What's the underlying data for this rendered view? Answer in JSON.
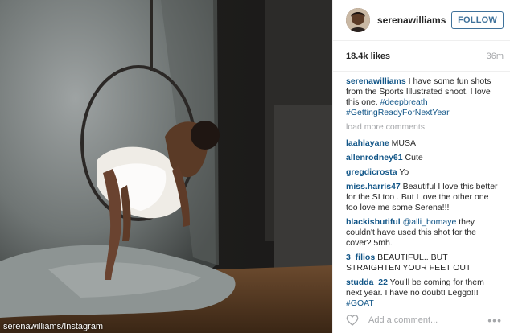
{
  "photo": {
    "credit": "serenawilliams/Instagram"
  },
  "header": {
    "username": "serenawilliams",
    "follow_label": "FOLLOW"
  },
  "meta": {
    "likes": "18.4k likes",
    "time": "36m"
  },
  "caption": {
    "author": "serenawilliams",
    "text": " I have some fun shots from the Sports Illustrated shoot. I love this one. ",
    "hashtags": "#deepbreath #GettingReadyForNextYear"
  },
  "load_more": "load more comments",
  "comments": [
    {
      "author": "laahlayane",
      "text": " MUSA"
    },
    {
      "author": "allenrodney61",
      "text": " Cute"
    },
    {
      "author": "gregdicrosta",
      "text": " Yo"
    },
    {
      "author": "miss.harris47",
      "text": " Beautiful I love this better for the SI too . But I love the other one too love me some Serena!!!"
    },
    {
      "author": "blackisbutiful",
      "mention": " @alli_bomaye",
      "text": " they couldn't have used this shot for the cover? 5mh."
    },
    {
      "author": "3_filios",
      "text": " BEAUTIFUL.. BUT STRAIGHTEN YOUR FEET OUT"
    },
    {
      "author": "studda_22",
      "text": " You'll be coming for them next year. I have no doubt! Leggo!!! ",
      "hashtag": "#GOAT"
    }
  ],
  "add_comment": {
    "placeholder": "Add a comment...",
    "more": "•••"
  },
  "icons": {
    "heart": "heart-icon",
    "more": "more-options-icon"
  }
}
